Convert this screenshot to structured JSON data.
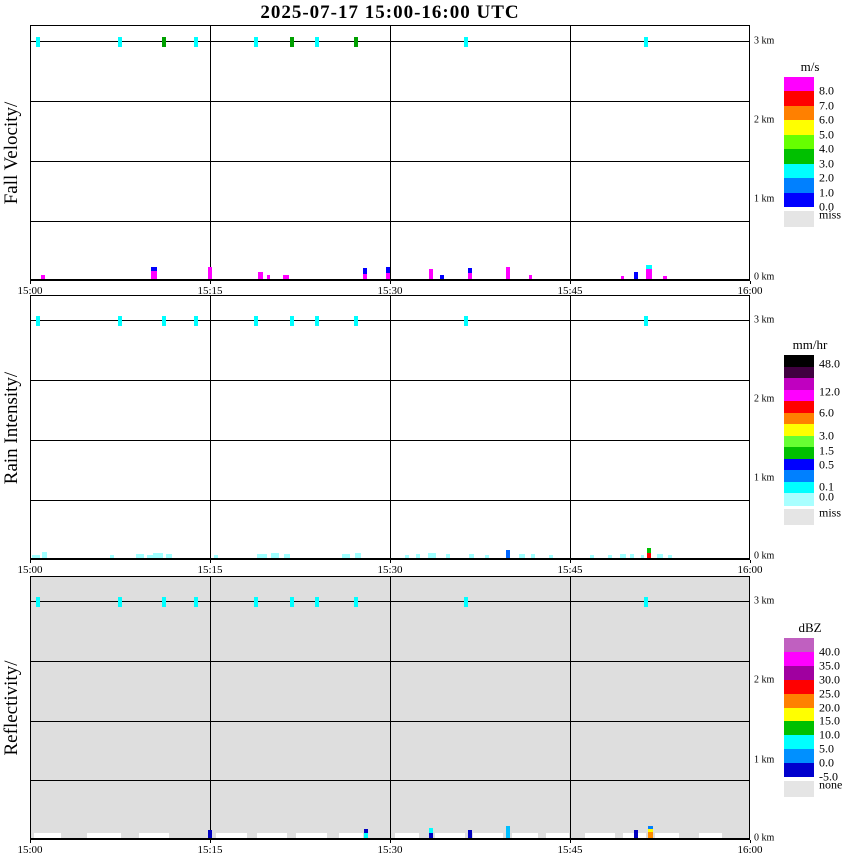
{
  "title": "2025-07-17  15:00-16:00 UTC",
  "chart_data": [
    {
      "type": "heatmap",
      "id": "fall-velocity",
      "ylabel": "Fall Velocity/",
      "unit": "m/s",
      "background": "#FFFFFF",
      "x_tick_labels": [
        "15:00",
        "15:15",
        "15:30",
        "15:45",
        "16:00"
      ],
      "x_gridlines_minutes": [
        15,
        30,
        45
      ],
      "y_tick_labels": [
        "3 km",
        "2 km",
        "1 km",
        "0 km"
      ],
      "legend": {
        "title": "m/s",
        "boxes": [
          "#FF00FF",
          "#FF0000",
          "#FF8000",
          "#FFFF00",
          "#66FF00",
          "#00C000",
          "#00FFFF",
          "#0080FF",
          "#0000FF"
        ],
        "labels": [
          {
            "text": "8.0",
            "edge": 1
          },
          {
            "text": "7.0",
            "edge": 2
          },
          {
            "text": "6.0",
            "edge": 3
          },
          {
            "text": "5.0",
            "edge": 4
          },
          {
            "text": "4.0",
            "edge": 5
          },
          {
            "text": "3.0",
            "edge": 6
          },
          {
            "text": "2.0",
            "edge": 7
          },
          {
            "text": "1.0",
            "edge": 8
          },
          {
            "text": "0.0",
            "edge": 9
          }
        ],
        "miss": {
          "label": "miss",
          "color": "#E5E5E5"
        }
      },
      "marks_3km": [
        {
          "t": 0.7,
          "color": "#00FFFF"
        },
        {
          "t": 7.5,
          "color": "#00FFFF"
        },
        {
          "t": 11.2,
          "color": "#00A000"
        },
        {
          "t": 13.8,
          "color": "#00FFFF"
        },
        {
          "t": 18.8,
          "color": "#00FFFF"
        },
        {
          "t": 21.8,
          "color": "#00A000"
        },
        {
          "t": 23.9,
          "color": "#00FFFF"
        },
        {
          "t": 27.2,
          "color": "#00A000"
        },
        {
          "t": 36.3,
          "color": "#00FFFF"
        },
        {
          "t": 51.3,
          "color": "#00FFFF"
        }
      ],
      "marks_surface": [
        {
          "t": 1.1,
          "w": 4,
          "segments": [
            {
              "color": "#FF00FF",
              "h": 4
            }
          ]
        },
        {
          "t": 10.3,
          "w": 6,
          "segments": [
            {
              "color": "#FF00FF",
              "h": 8
            },
            {
              "color": "#0000FF",
              "h": 4
            }
          ]
        },
        {
          "t": 15.0,
          "w": 4,
          "segments": [
            {
              "color": "#FF00FF",
              "h": 12
            }
          ]
        },
        {
          "t": 19.2,
          "w": 5,
          "segments": [
            {
              "color": "#FF00FF",
              "h": 7
            }
          ]
        },
        {
          "t": 19.9,
          "w": 3,
          "segments": [
            {
              "color": "#FF00FF",
              "h": 4
            }
          ]
        },
        {
          "t": 21.3,
          "w": 6,
          "segments": [
            {
              "color": "#FF00FF",
              "h": 4
            }
          ]
        },
        {
          "t": 27.9,
          "w": 4,
          "segments": [
            {
              "color": "#FF00FF",
              "h": 5
            },
            {
              "color": "#0000FF",
              "h": 6
            }
          ]
        },
        {
          "t": 29.8,
          "w": 4,
          "segments": [
            {
              "color": "#FF00FF",
              "h": 6
            },
            {
              "color": "#0000FF",
              "h": 6
            }
          ]
        },
        {
          "t": 33.4,
          "w": 4,
          "segments": [
            {
              "color": "#FF00FF",
              "h": 10
            }
          ]
        },
        {
          "t": 34.3,
          "w": 4,
          "segments": [
            {
              "color": "#0000FF",
              "h": 4
            }
          ]
        },
        {
          "t": 36.7,
          "w": 4,
          "segments": [
            {
              "color": "#FF00FF",
              "h": 6
            },
            {
              "color": "#0000FF",
              "h": 5
            }
          ]
        },
        {
          "t": 39.8,
          "w": 4,
          "segments": [
            {
              "color": "#FF00FF",
              "h": 12
            }
          ]
        },
        {
          "t": 41.7,
          "w": 3,
          "segments": [
            {
              "color": "#FF00FF",
              "h": 4
            }
          ]
        },
        {
          "t": 49.4,
          "w": 3,
          "segments": [
            {
              "color": "#FF00FF",
              "h": 3
            }
          ]
        },
        {
          "t": 50.5,
          "w": 4,
          "segments": [
            {
              "color": "#0000FF",
              "h": 7
            }
          ]
        },
        {
          "t": 51.6,
          "w": 6,
          "segments": [
            {
              "color": "#FF00FF",
              "h": 10
            },
            {
              "color": "#00FFFF",
              "h": 4
            }
          ]
        },
        {
          "t": 52.9,
          "w": 4,
          "segments": [
            {
              "color": "#FF00FF",
              "h": 3
            }
          ]
        }
      ],
      "white_patches": []
    },
    {
      "type": "heatmap",
      "id": "rain-intensity",
      "ylabel": "Rain Intensity/",
      "unit": "mm/hr",
      "background": "#FFFFFF",
      "x_tick_labels": [
        "15:00",
        "15:15",
        "15:30",
        "15:45",
        "16:00"
      ],
      "x_gridlines_minutes": [
        15,
        30,
        45
      ],
      "y_tick_labels": [
        "3 km",
        "2 km",
        "1 km",
        "0 km"
      ],
      "legend": {
        "title": "mm/hr",
        "boxes": [
          "#000000",
          "#400040",
          "#C000C0",
          "#FF00FF",
          "#FF0000",
          "#FF8000",
          "#FFFF00",
          "#66FF33",
          "#00C000",
          "#0000FF",
          "#0080FF",
          "#00FFFF",
          "#A8FFFF"
        ],
        "labels": [
          {
            "text": "48.0",
            "edge": 0.8
          },
          {
            "text": "12.0",
            "edge": 3.2
          },
          {
            "text": "6.0",
            "edge": 5.0
          },
          {
            "text": "3.0",
            "edge": 7.0
          },
          {
            "text": "1.5",
            "edge": 8.3
          },
          {
            "text": "0.5",
            "edge": 9.5
          },
          {
            "text": "0.1",
            "edge": 11.4
          },
          {
            "text": "0.0",
            "edge": 12.3
          }
        ],
        "miss": {
          "label": "miss",
          "color": "#E5E5E5"
        }
      },
      "marks_3km": [
        {
          "t": 0.7,
          "color": "#00FFFF"
        },
        {
          "t": 7.5,
          "color": "#00FFFF"
        },
        {
          "t": 11.2,
          "color": "#00FFFF"
        },
        {
          "t": 13.8,
          "color": "#00FFFF"
        },
        {
          "t": 18.8,
          "color": "#00FFFF"
        },
        {
          "t": 21.8,
          "color": "#00FFFF"
        },
        {
          "t": 23.9,
          "color": "#00FFFF"
        },
        {
          "t": 27.2,
          "color": "#00FFFF"
        },
        {
          "t": 36.3,
          "color": "#00FFFF"
        },
        {
          "t": 51.3,
          "color": "#00FFFF"
        }
      ],
      "marks_surface": [
        {
          "t": 0.5,
          "w": 8,
          "segments": [
            {
              "color": "#A0FFFF",
              "h": 3
            }
          ]
        },
        {
          "t": 1.2,
          "w": 5,
          "segments": [
            {
              "color": "#A0FFFF",
              "h": 6
            }
          ]
        },
        {
          "t": 6.8,
          "w": 4,
          "segments": [
            {
              "color": "#A0FFFF",
              "h": 3
            }
          ]
        },
        {
          "t": 9.2,
          "w": 8,
          "segments": [
            {
              "color": "#A0FFFF",
              "h": 4
            }
          ]
        },
        {
          "t": 10.0,
          "w": 6,
          "segments": [
            {
              "color": "#A0FFFF",
              "h": 3
            }
          ]
        },
        {
          "t": 10.7,
          "w": 10,
          "segments": [
            {
              "color": "#A0FFFF",
              "h": 5
            }
          ]
        },
        {
          "t": 11.6,
          "w": 6,
          "segments": [
            {
              "color": "#A0FFFF",
              "h": 4
            }
          ]
        },
        {
          "t": 15.5,
          "w": 4,
          "segments": [
            {
              "color": "#A0FFFF",
              "h": 3
            }
          ]
        },
        {
          "t": 19.3,
          "w": 10,
          "segments": [
            {
              "color": "#A0FFFF",
              "h": 4
            }
          ]
        },
        {
          "t": 20.4,
          "w": 8,
          "segments": [
            {
              "color": "#A0FFFF",
              "h": 5
            }
          ]
        },
        {
          "t": 21.4,
          "w": 6,
          "segments": [
            {
              "color": "#A0FFFF",
              "h": 4
            }
          ]
        },
        {
          "t": 26.3,
          "w": 8,
          "segments": [
            {
              "color": "#A0FFFF",
              "h": 4
            }
          ]
        },
        {
          "t": 27.3,
          "w": 6,
          "segments": [
            {
              "color": "#A0FFFF",
              "h": 5
            }
          ]
        },
        {
          "t": 31.4,
          "w": 4,
          "segments": [
            {
              "color": "#A0FFFF",
              "h": 3
            }
          ]
        },
        {
          "t": 32.3,
          "w": 4,
          "segments": [
            {
              "color": "#A0FFFF",
              "h": 4
            }
          ]
        },
        {
          "t": 33.5,
          "w": 8,
          "segments": [
            {
              "color": "#A0FFFF",
              "h": 5
            }
          ]
        },
        {
          "t": 34.8,
          "w": 4,
          "segments": [
            {
              "color": "#A0FFFF",
              "h": 4
            }
          ]
        },
        {
          "t": 36.8,
          "w": 5,
          "segments": [
            {
              "color": "#A0FFFF",
              "h": 4
            }
          ]
        },
        {
          "t": 38.1,
          "w": 4,
          "segments": [
            {
              "color": "#A0FFFF",
              "h": 3
            }
          ]
        },
        {
          "t": 39.8,
          "w": 4,
          "segments": [
            {
              "color": "#0066FF",
              "h": 8
            }
          ]
        },
        {
          "t": 41.0,
          "w": 6,
          "segments": [
            {
              "color": "#A0FFFF",
              "h": 4
            }
          ]
        },
        {
          "t": 41.9,
          "w": 4,
          "segments": [
            {
              "color": "#A0FFFF",
              "h": 4
            }
          ]
        },
        {
          "t": 43.4,
          "w": 4,
          "segments": [
            {
              "color": "#A0FFFF",
              "h": 3
            }
          ]
        },
        {
          "t": 46.8,
          "w": 4,
          "segments": [
            {
              "color": "#A0FFFF",
              "h": 3
            }
          ]
        },
        {
          "t": 48.3,
          "w": 4,
          "segments": [
            {
              "color": "#A0FFFF",
              "h": 3
            }
          ]
        },
        {
          "t": 49.4,
          "w": 6,
          "segments": [
            {
              "color": "#A0FFFF",
              "h": 4
            }
          ]
        },
        {
          "t": 50.2,
          "w": 4,
          "segments": [
            {
              "color": "#A0FFFF",
              "h": 4
            }
          ]
        },
        {
          "t": 51.0,
          "w": 3,
          "segments": [
            {
              "color": "#A0FFFF",
              "h": 3
            }
          ]
        },
        {
          "t": 51.6,
          "w": 4,
          "segments": [
            {
              "color": "#FF0000",
              "h": 5
            },
            {
              "color": "#00C000",
              "h": 5
            }
          ]
        },
        {
          "t": 52.5,
          "w": 6,
          "segments": [
            {
              "color": "#A0FFFF",
              "h": 4
            }
          ]
        },
        {
          "t": 53.3,
          "w": 4,
          "segments": [
            {
              "color": "#A0FFFF",
              "h": 3
            }
          ]
        }
      ],
      "white_patches": []
    },
    {
      "type": "heatmap",
      "id": "reflectivity",
      "ylabel": "Reflectivity/",
      "unit": "dBZ",
      "background": "#DEDEDE",
      "x_tick_labels": [
        "15:00",
        "15:15",
        "15:30",
        "15:45",
        "16:00"
      ],
      "x_gridlines_minutes": [
        15,
        30,
        45
      ],
      "y_tick_labels": [
        "3 km",
        "2 km",
        "1 km",
        "0 km"
      ],
      "legend": {
        "title": "dBZ",
        "boxes": [
          "#C060C0",
          "#FF00FF",
          "#A000A0",
          "#FF0000",
          "#FF8000",
          "#FFFF00",
          "#00C000",
          "#00FFFF",
          "#0090FF",
          "#0000CD"
        ],
        "labels": [
          {
            "text": "40.0",
            "edge": 1
          },
          {
            "text": "35.0",
            "edge": 2
          },
          {
            "text": "30.0",
            "edge": 3
          },
          {
            "text": "25.0",
            "edge": 4
          },
          {
            "text": "20.0",
            "edge": 5
          },
          {
            "text": "15.0",
            "edge": 6
          },
          {
            "text": "10.0",
            "edge": 7
          },
          {
            "text": "5.0",
            "edge": 8
          },
          {
            "text": "0.0",
            "edge": 9
          },
          {
            "text": "-5.0",
            "edge": 10
          }
        ],
        "miss": {
          "label": "none",
          "color": "#E5E5E5"
        }
      },
      "marks_3km": [
        {
          "t": 0.7,
          "color": "#00FFFF"
        },
        {
          "t": 7.5,
          "color": "#00FFFF"
        },
        {
          "t": 11.2,
          "color": "#00FFFF"
        },
        {
          "t": 13.8,
          "color": "#00FFFF"
        },
        {
          "t": 18.8,
          "color": "#00FFFF"
        },
        {
          "t": 21.8,
          "color": "#00FFFF"
        },
        {
          "t": 23.9,
          "color": "#00FFFF"
        },
        {
          "t": 27.2,
          "color": "#00FFFF"
        },
        {
          "t": 36.3,
          "color": "#00FFFF"
        },
        {
          "t": 51.3,
          "color": "#00FFFF"
        }
      ],
      "marks_surface": [
        {
          "t": 15.0,
          "w": 4,
          "segments": [
            {
              "color": "#0000C0",
              "h": 8
            }
          ]
        },
        {
          "t": 28.0,
          "w": 4,
          "segments": [
            {
              "color": "#00FFFF",
              "h": 5
            },
            {
              "color": "#0000C0",
              "h": 4
            }
          ]
        },
        {
          "t": 33.4,
          "w": 4,
          "segments": [
            {
              "color": "#0000C0",
              "h": 5
            },
            {
              "color": "#00FFFF",
              "h": 5
            }
          ]
        },
        {
          "t": 36.7,
          "w": 4,
          "segments": [
            {
              "color": "#0000C0",
              "h": 8
            }
          ]
        },
        {
          "t": 39.8,
          "w": 4,
          "segments": [
            {
              "color": "#00BFFF",
              "h": 12
            }
          ]
        },
        {
          "t": 50.5,
          "w": 4,
          "segments": [
            {
              "color": "#0000C0",
              "h": 8
            }
          ]
        },
        {
          "t": 51.7,
          "w": 5,
          "segments": [
            {
              "color": "#FF8C00",
              "h": 6
            },
            {
              "color": "#FFFF00",
              "h": 3
            },
            {
              "color": "#0080FF",
              "h": 3
            }
          ]
        }
      ],
      "white_patches": [
        [
          0.25,
          2.5
        ],
        [
          4.7,
          7.5
        ],
        [
          9.0,
          11.5
        ],
        [
          15.4,
          18.0
        ],
        [
          18.8,
          21.3
        ],
        [
          22.1,
          24.7
        ],
        [
          25.7,
          27.7
        ],
        [
          30.3,
          32.3
        ],
        [
          33.7,
          36.2
        ],
        [
          36.8,
          39.3
        ],
        [
          40.1,
          42.3
        ],
        [
          42.9,
          44.8
        ],
        [
          46.2,
          48.7
        ],
        [
          49.3,
          51.2
        ],
        [
          52.0,
          54.0
        ],
        [
          55.7,
          57.6
        ]
      ]
    }
  ]
}
